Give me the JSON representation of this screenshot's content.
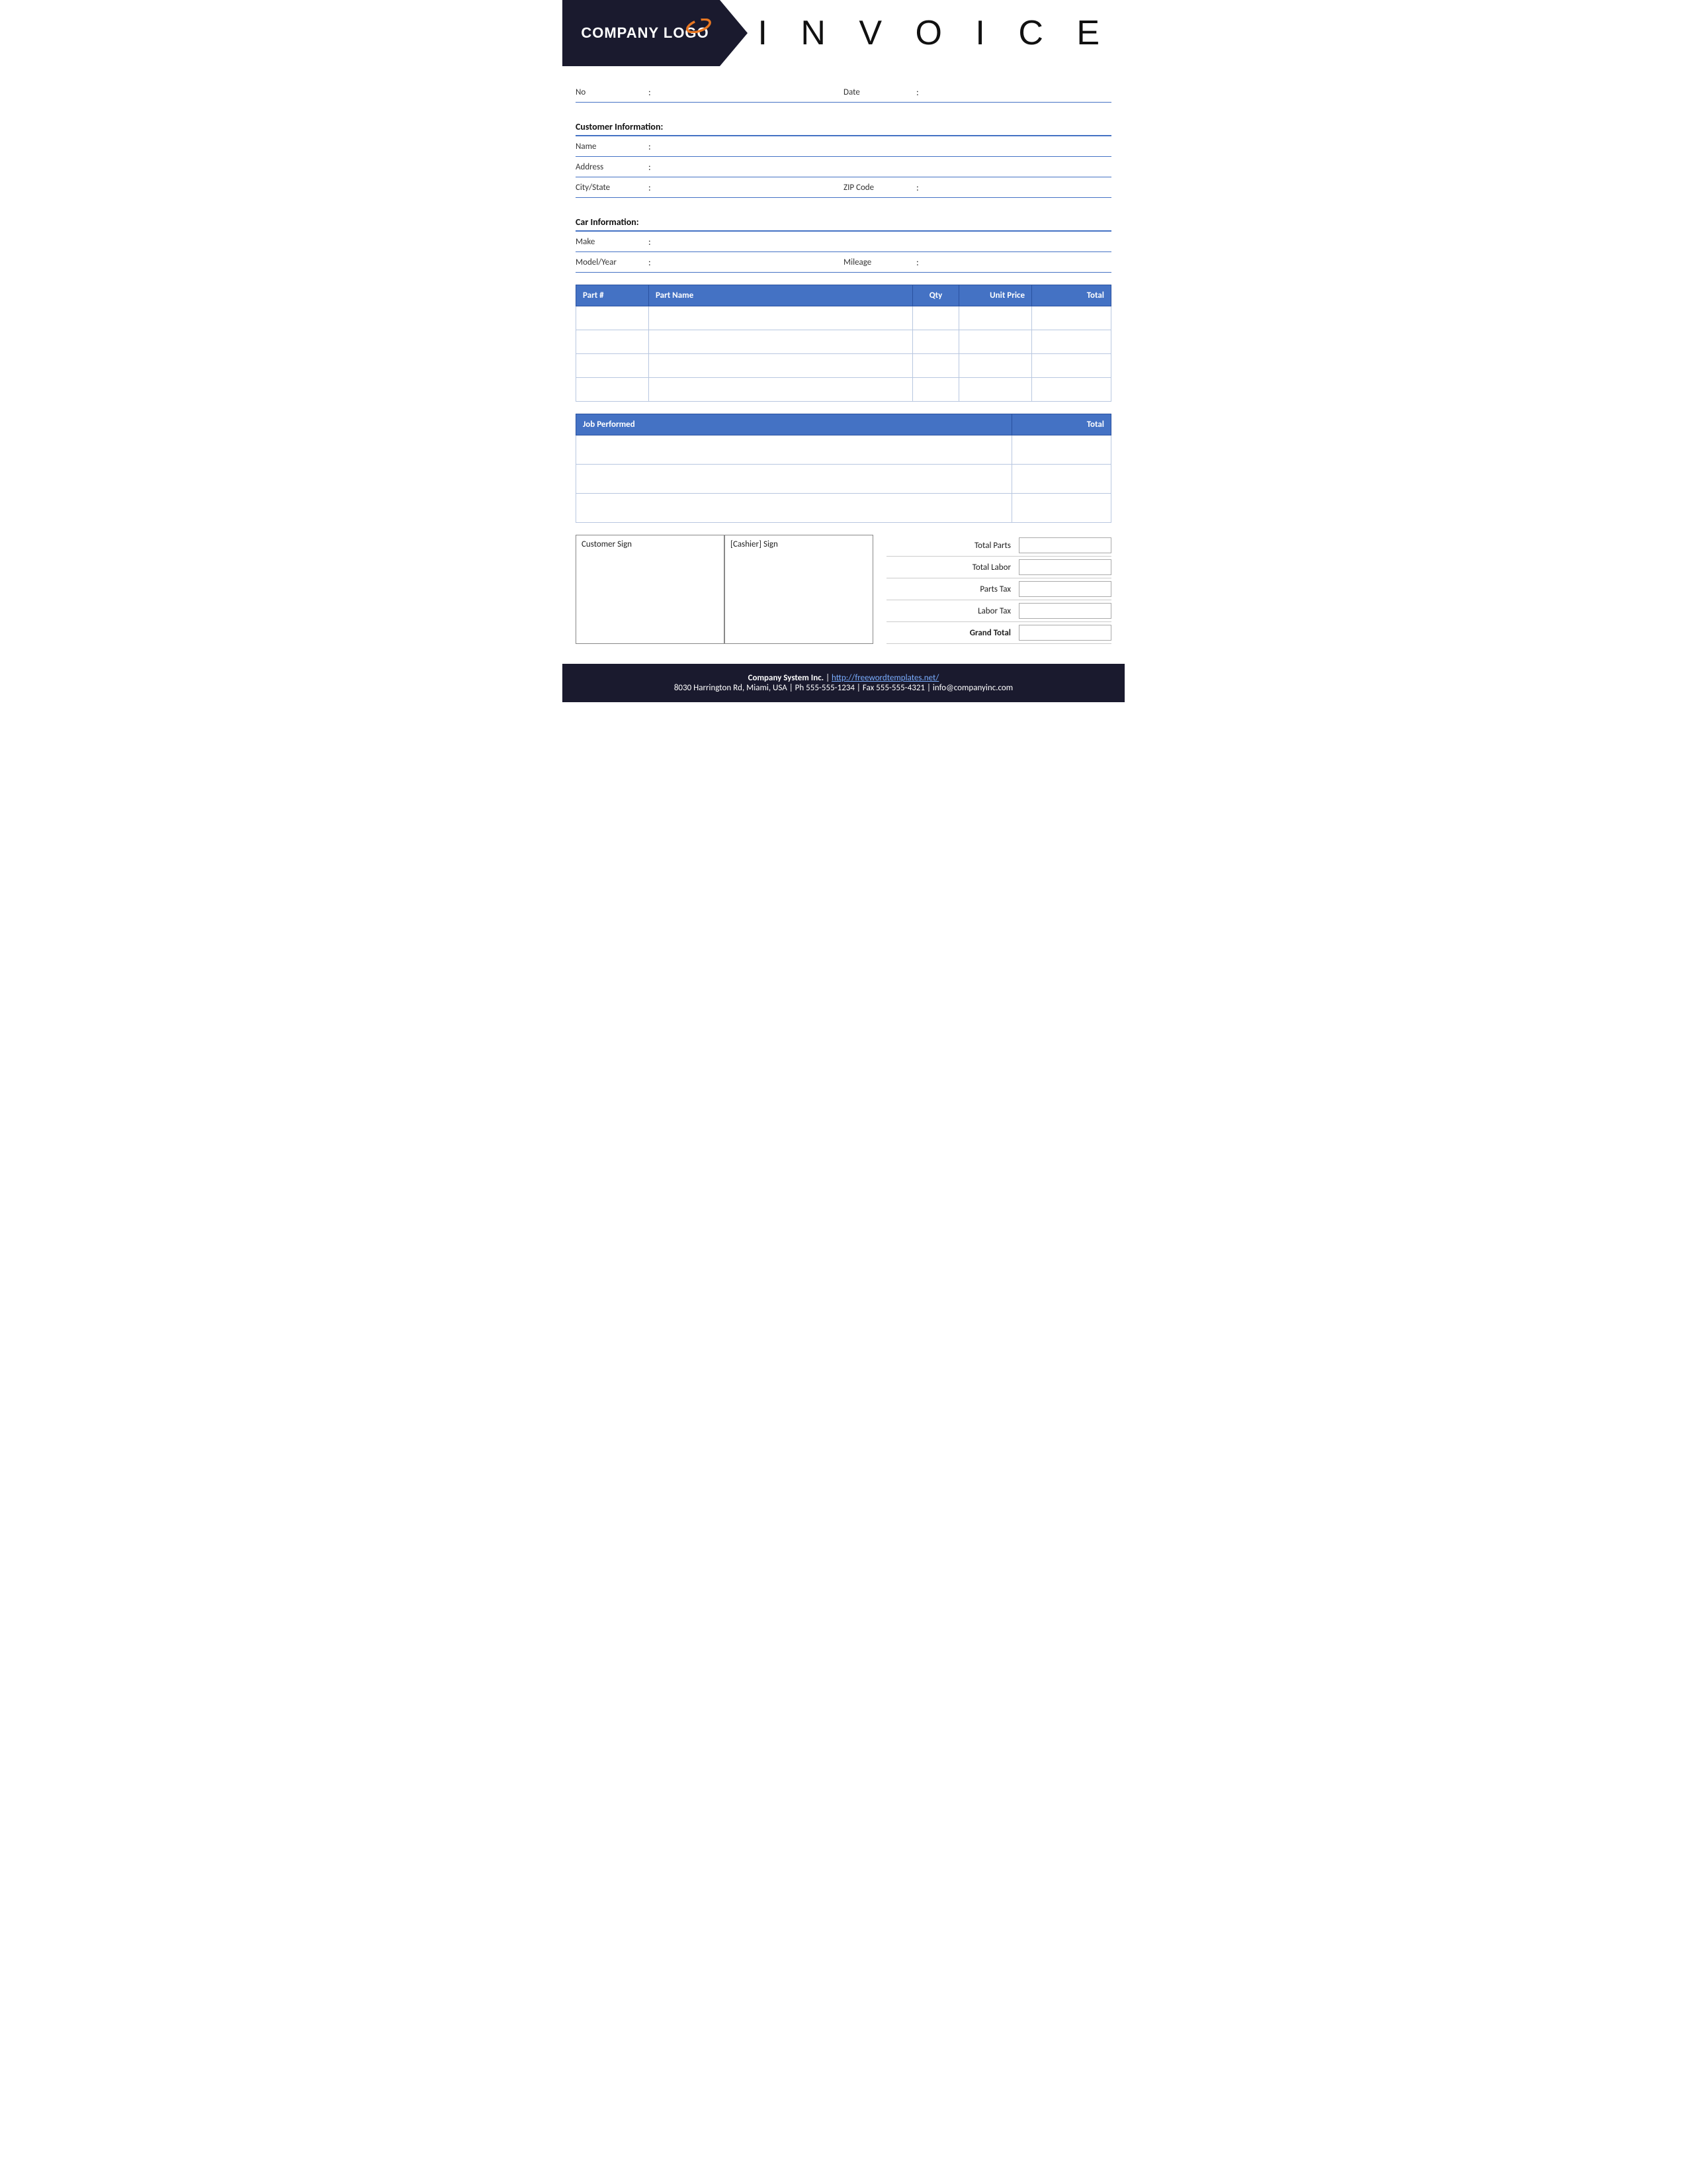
{
  "header": {
    "logo_text": "COMPANY LOGO",
    "title": "I N V O I C E"
  },
  "invoice_fields": {
    "no_label": "No",
    "no_colon": ":",
    "date_label": "Date",
    "date_colon": ":"
  },
  "customer_section": {
    "title": "Customer Information:",
    "name_label": "Name",
    "name_colon": ":",
    "address_label": "Address",
    "address_colon": ":",
    "citystate_label": "City/State",
    "citystate_colon": ":",
    "zipcode_label": "ZIP Code",
    "zipcode_colon": ":"
  },
  "car_section": {
    "title": "Car Information:",
    "make_label": "Make",
    "make_colon": ":",
    "modelyear_label": "Model/Year",
    "modelyear_colon": ":",
    "mileage_label": "Mileage",
    "mileage_colon": ":"
  },
  "parts_table": {
    "col_part": "Part #",
    "col_name": "Part Name",
    "col_qty": "Qty",
    "col_unit_price": "Unit Price",
    "col_total": "Total",
    "rows": [
      {
        "part": "",
        "name": "",
        "qty": "",
        "unit_price": "",
        "total": ""
      },
      {
        "part": "",
        "name": "",
        "qty": "",
        "unit_price": "",
        "total": ""
      },
      {
        "part": "",
        "name": "",
        "qty": "",
        "unit_price": "",
        "total": ""
      },
      {
        "part": "",
        "name": "",
        "qty": "",
        "unit_price": "",
        "total": ""
      }
    ]
  },
  "job_table": {
    "col_job": "Job Performed",
    "col_total": "Total",
    "rows": [
      {
        "job": "",
        "total": ""
      },
      {
        "job": "",
        "total": ""
      },
      {
        "job": "",
        "total": ""
      },
      {
        "job": "",
        "total": ""
      }
    ]
  },
  "signatures": {
    "customer_sign": "Customer Sign",
    "cashier_sign": "[Cashier] Sign"
  },
  "totals": {
    "total_parts_label": "Total Parts",
    "total_labor_label": "Total Labor",
    "parts_tax_label": "Parts Tax",
    "labor_tax_label": "Labor Tax",
    "grand_total_label": "Grand Total"
  },
  "footer": {
    "company_name": "Company System Inc.",
    "pipe": " | ",
    "website": "http://freewordtemplates.net/",
    "address": "8030 Harrington Rd, Miami, USA | Ph 555-555-1234 | Fax 555-555-4321 | info@companyinc.com"
  }
}
